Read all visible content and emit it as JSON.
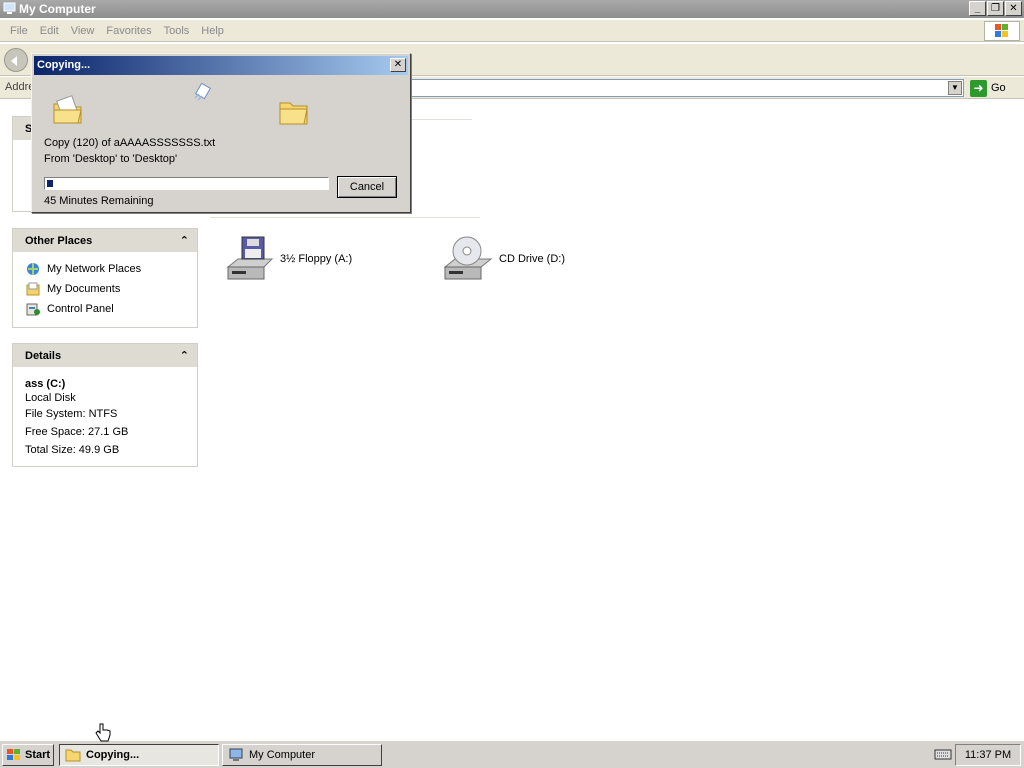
{
  "window": {
    "title": "My Computer"
  },
  "menu": [
    "File",
    "Edit",
    "View",
    "Favorites",
    "Tools",
    "Help"
  ],
  "address": {
    "label": "Addre",
    "go_label": "Go"
  },
  "other_places": {
    "title": "Other Places",
    "items": [
      {
        "label": "My Network Places",
        "icon": "network-icon"
      },
      {
        "label": "My Documents",
        "icon": "documents-icon"
      },
      {
        "label": "Control Panel",
        "icon": "control-panel-icon"
      }
    ]
  },
  "details": {
    "title": "Details",
    "name": "ass (C:)",
    "type": "Local Disk",
    "file_system": "File System: NTFS",
    "free_space": "Free Space: 27.1 GB",
    "total_size": "Total Size: 49.9 GB"
  },
  "system_tasks_partial": "S",
  "drives": [
    {
      "label": "3½ Floppy (A:)",
      "icon": "floppy-drive-icon"
    },
    {
      "label": "CD Drive (D:)",
      "icon": "cd-drive-icon"
    }
  ],
  "dialog": {
    "title": "Copying...",
    "line1": "Copy (120) of aAAAASSSSSSS.txt",
    "line2": "From 'Desktop' to 'Desktop'",
    "progress_fraction": 0.02,
    "remaining": "45 Minutes Remaining",
    "cancel_label": "Cancel"
  },
  "taskbar": {
    "start_label": "Start",
    "tasks": [
      {
        "label": "Copying...",
        "active": true
      },
      {
        "label": "My Computer",
        "active": false
      }
    ],
    "clock": "11:37 PM"
  },
  "colors": {
    "title_inactive": "#999999",
    "dialog_title": "#0a246a",
    "progress": "#0a246a",
    "panel_header": "#dedbd2"
  }
}
